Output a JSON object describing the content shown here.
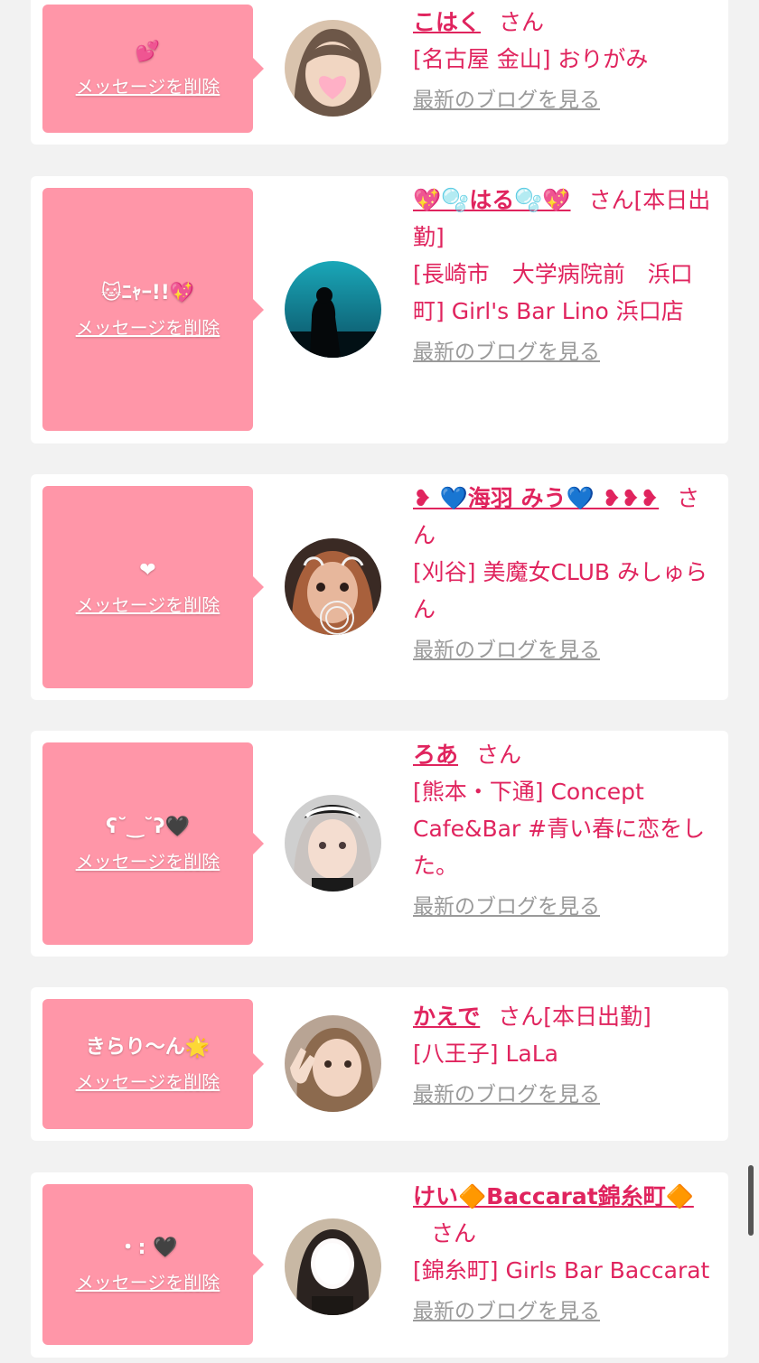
{
  "cards": [
    {
      "message": "💕",
      "delete_label": "メッセージを削除",
      "name": "こはく",
      "san": "さん",
      "status": "",
      "shop": "[名古屋 金山] おりがみ",
      "blog_label": "最新のブログを見る",
      "avatar_icon": "avatar-hair-blurred-heart"
    },
    {
      "message": "🐱ﾆｬｰ!!💖",
      "delete_label": "メッセージを削除",
      "name": "💖🫧はる🫧💖",
      "san": "さん",
      "status": "[本日出勤]",
      "shop": "[長崎市　大学病院前　浜口町] Girl's Bar Lino 浜口店",
      "blog_label": "最新のブログを見る",
      "avatar_icon": "avatar-aquarium-silhouette"
    },
    {
      "message": "❤",
      "delete_label": "メッセージを削除",
      "name": "❥ 💙海羽 みう💙 ❥❥❥",
      "san": "さん",
      "status": "",
      "shop": "[刈谷] 美魔女CLUB みしゅらん",
      "blog_label": "最新のブログを見る",
      "avatar_icon": "avatar-cat-filter"
    },
    {
      "message": "ʕ˘‿˘ʔ🖤",
      "delete_label": "メッセージを削除",
      "name": "ろあ",
      "san": "さん",
      "status": "",
      "shop": "[熊本・下通] Concept Cafe&Bar #青い春に恋をした。",
      "blog_label": "最新のブログを見る",
      "avatar_icon": "avatar-maid-headdress"
    },
    {
      "message": "きらり〜ん🌟",
      "delete_label": "メッセージを削除",
      "name": "かえで",
      "san": "さん",
      "status": "[本日出勤]",
      "shop": "[八王子] LaLa",
      "blog_label": "最新のブログを見る",
      "avatar_icon": "avatar-peace-sign"
    },
    {
      "message": "・: 🖤",
      "delete_label": "メッセージを削除",
      "name": "けい🔶Baccarat錦糸町🔶",
      "san": "さん",
      "status": "",
      "shop": "[錦糸町] Girls Bar Baccarat",
      "blog_label": "最新のブログを見る",
      "avatar_icon": "avatar-blurred-face"
    }
  ],
  "colors": {
    "background": "#f2f2f2",
    "card": "#ffffff",
    "bubble": "#ff96a8",
    "accent": "#e0245e",
    "link_gray": "#9a9a9a"
  }
}
